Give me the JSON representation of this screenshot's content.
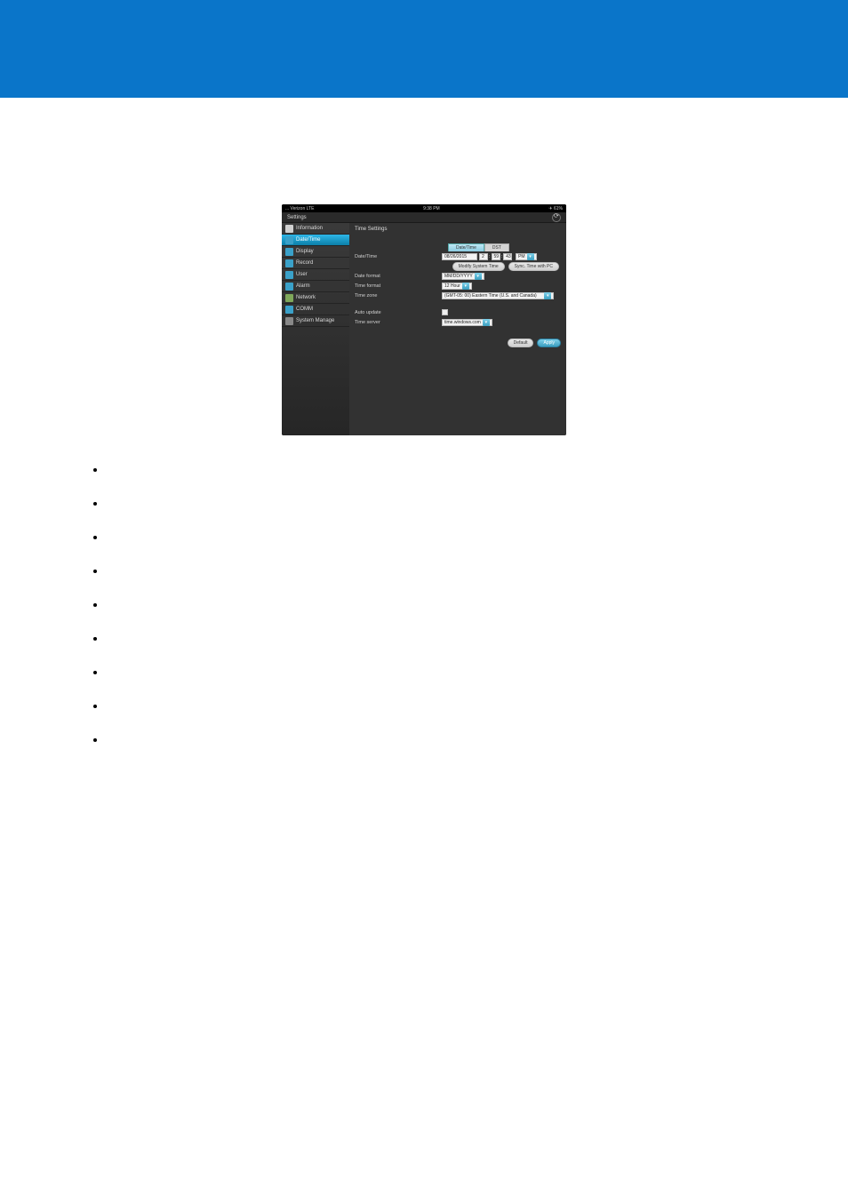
{
  "shot": {
    "status_left": "... Verizon  LTE",
    "status_center": "9:38 PM",
    "status_right": "✈  61%",
    "titlebar_back": "Settings",
    "nav": {
      "information": "Information",
      "datetime": "Date/Time",
      "display": "Display",
      "record": "Record",
      "user": "User",
      "alarm": "Alarm",
      "network": "Network",
      "comm": "COMM",
      "system_manage": "System Manage"
    },
    "panel_title": "Time Settings",
    "tabs": {
      "datetime": "Date/Time",
      "dst": "DST"
    },
    "labels": {
      "datetime": "Date/Time",
      "date_format": "Date format",
      "time_format": "Time format",
      "time_zone": "Time zone",
      "auto_update": "Auto update",
      "time_server": "Time server"
    },
    "values": {
      "date": "08/26/2015",
      "hour": "2",
      "minute": "59",
      "second": "43",
      "ampm": "PM",
      "modify_btn": "Modify System Time",
      "sync_btn": "Sync. Time with PC",
      "date_format": "MM/DD/YYYY",
      "time_format": "12 Hour",
      "time_zone": "(GMT-05: 00) Eastern Time (U.S. and Canada)",
      "time_server": "time.windows.com"
    },
    "buttons": {
      "default": "Default",
      "apply": "Apply"
    }
  },
  "bullets": [
    "",
    "",
    "",
    "",
    "",
    "",
    "",
    "",
    ""
  ]
}
